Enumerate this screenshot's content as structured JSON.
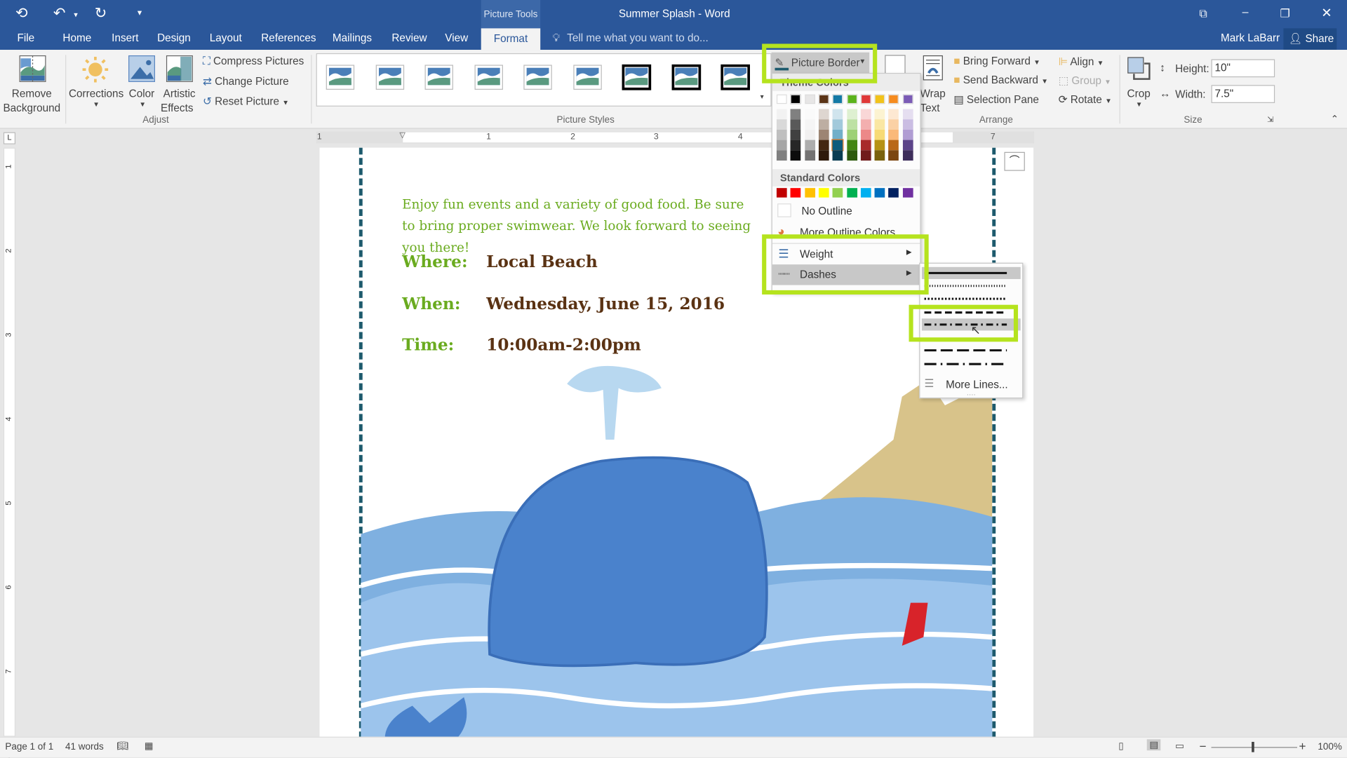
{
  "window": {
    "title": "Summer Splash - Word",
    "context_tab": "Picture Tools",
    "user": "Mark LaBarr",
    "share": "Share"
  },
  "tabs": [
    "File",
    "Home",
    "Insert",
    "Design",
    "Layout",
    "References",
    "Mailings",
    "Review",
    "View",
    "Format"
  ],
  "active_tab": "Format",
  "tell_me": "Tell me what you want to do...",
  "ribbon": {
    "adjust": {
      "remove_bg": [
        "Remove",
        "Background"
      ],
      "corrections": "Corrections",
      "color": "Color",
      "artistic": [
        "Artistic",
        "Effects"
      ],
      "compress": "Compress Pictures",
      "change": "Change Picture",
      "reset": "Reset Picture",
      "group": "Adjust"
    },
    "styles_group": "Picture Styles",
    "picture_border": "Picture Border",
    "arrange": {
      "wrap": [
        "Wrap",
        "Text"
      ],
      "bring_forward": "Bring Forward",
      "send_backward": "Send Backward",
      "selection_pane": "Selection Pane",
      "align": "Align",
      "group_btn": "Group",
      "rotate": "Rotate",
      "group": "Arrange"
    },
    "size": {
      "crop": "Crop",
      "height_label": "Height:",
      "height": "10\"",
      "width_label": "Width:",
      "width": "7.5\"",
      "group": "Size"
    }
  },
  "border_menu": {
    "theme_header": "Theme Colors",
    "theme_colors": [
      "#ffffff",
      "#000000",
      "#e7e6e6",
      "#5b3416",
      "#1379a5",
      "#5bb31b",
      "#e03838",
      "#f2c31a",
      "#f68b1f",
      "#7b5bb6"
    ],
    "standard_header": "Standard Colors",
    "standard_colors": [
      "#c00000",
      "#ff0000",
      "#ffc000",
      "#ffff00",
      "#92d050",
      "#00b050",
      "#00b0f0",
      "#0070c0",
      "#002060",
      "#7030a0"
    ],
    "no_outline": "No Outline",
    "more_colors": "More Outline Colors...",
    "weight": "Weight",
    "dashes": "Dashes"
  },
  "dashes_menu": {
    "styles": [
      "Solid",
      "Round Dot",
      "Square Dot",
      "Dash",
      "Dash Dot",
      "Long Dash",
      "Long Dash Dot",
      "Long Dash Dot Dot"
    ],
    "selected": "Dash Dot",
    "more": "More Lines..."
  },
  "ruler": {
    "marks": [
      "1",
      "1",
      "2",
      "3",
      "4",
      "5",
      "6",
      "7"
    ]
  },
  "document": {
    "intro": "Enjoy fun events and a variety of good food. Be sure to bring proper swimwear. We look forward to seeing you there!",
    "rows": [
      {
        "label": "Where:",
        "value": "Local Beach"
      },
      {
        "label": "When:",
        "value": "Wednesday, June 15, 2016"
      },
      {
        "label": "Time:",
        "value": "10:00am-2:00pm"
      }
    ],
    "accent_green": "#6aab1f",
    "accent_brown": "#5a3213",
    "border_color": "#1d5a6d"
  },
  "status": {
    "page": "Page 1 of 1",
    "words": "41 words",
    "zoom": "100%"
  },
  "highlight_color": "#b5e31e"
}
